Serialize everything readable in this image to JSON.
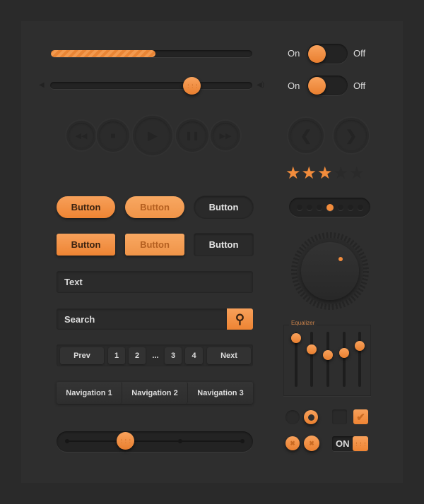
{
  "colors": {
    "accent": "#f28c3c",
    "background": "#2e2e2e"
  },
  "progress": {
    "value_percent": 52
  },
  "volume": {
    "value_percent": 70,
    "left_icon": "speaker-low-icon",
    "right_icon": "speaker-high-icon"
  },
  "toggles": [
    {
      "on": "On",
      "off": "Off",
      "state": "on"
    },
    {
      "on": "On",
      "off": "Off",
      "state": "on"
    }
  ],
  "media": [
    "rewind-icon",
    "stop-icon",
    "play-icon",
    "pause-icon",
    "fast-forward-icon"
  ],
  "arrows": [
    "chevron-left-icon",
    "chevron-right-icon"
  ],
  "rating": {
    "value": 3,
    "max": 5
  },
  "buttons": {
    "row1": [
      "Button",
      "Button",
      "Button"
    ],
    "row2": [
      "Button",
      "Button",
      "Button"
    ]
  },
  "pager_dots": {
    "count": 7,
    "active": 4
  },
  "text_input": {
    "value": "Text"
  },
  "search": {
    "value": "Search",
    "icon": "search-icon"
  },
  "pagination": {
    "prev": "Prev",
    "pages": [
      "1",
      "2",
      "...",
      "3",
      "4"
    ],
    "next": "Next"
  },
  "navigation": [
    "Navigation 1",
    "Navigation 2",
    "Navigation 3"
  ],
  "range_slider": {
    "value_percent": 33
  },
  "equalizer": {
    "label": "Equalizer",
    "levels_percent": [
      88,
      68,
      58,
      62,
      74
    ]
  },
  "switch": {
    "label": "ON"
  }
}
